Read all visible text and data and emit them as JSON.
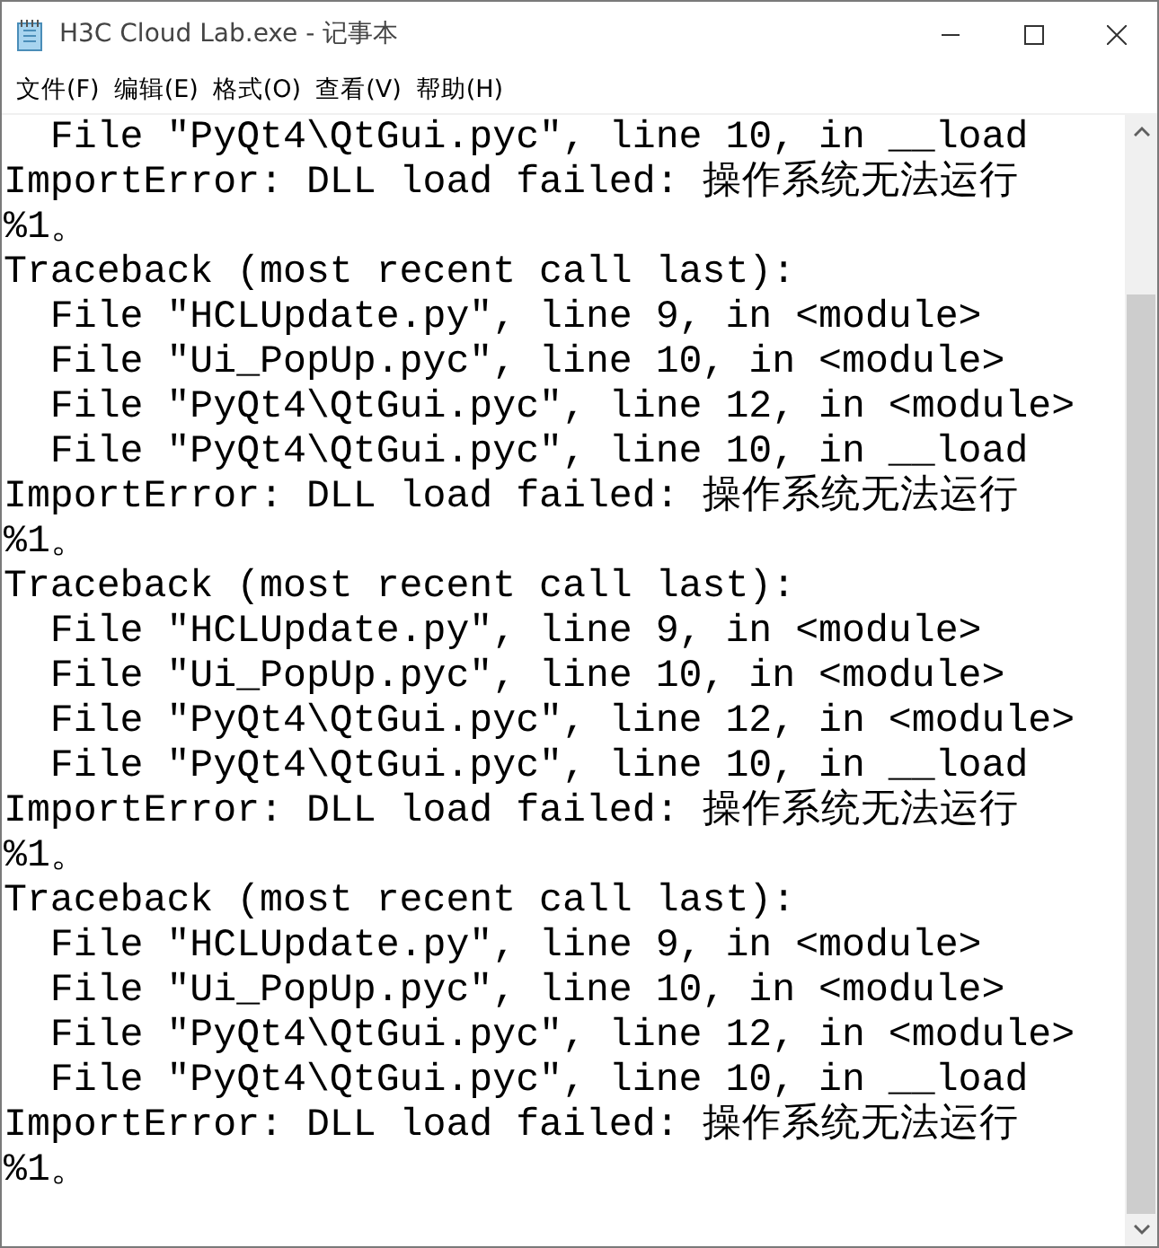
{
  "window": {
    "title": "H3C Cloud Lab.exe - 记事本"
  },
  "menu": [
    "文件(F)",
    "编辑(E)",
    "格式(O)",
    "查看(V)",
    "帮助(H)"
  ],
  "lines": [
    "  File \"PyQt4\\QtGui.pyc\", line 10, in __load",
    "ImportError: DLL load failed: 操作系统无法运行",
    "%1。",
    "Traceback (most recent call last):",
    "  File \"HCLUpdate.py\", line 9, in <module>",
    "  File \"Ui_PopUp.pyc\", line 10, in <module>",
    "  File \"PyQt4\\QtGui.pyc\", line 12, in <module>",
    "  File \"PyQt4\\QtGui.pyc\", line 10, in __load",
    "ImportError: DLL load failed: 操作系统无法运行",
    "%1。",
    "Traceback (most recent call last):",
    "  File \"HCLUpdate.py\", line 9, in <module>",
    "  File \"Ui_PopUp.pyc\", line 10, in <module>",
    "  File \"PyQt4\\QtGui.pyc\", line 12, in <module>",
    "  File \"PyQt4\\QtGui.pyc\", line 10, in __load",
    "ImportError: DLL load failed: 操作系统无法运行",
    "%1。",
    "Traceback (most recent call last):",
    "  File \"HCLUpdate.py\", line 9, in <module>",
    "  File \"Ui_PopUp.pyc\", line 10, in <module>",
    "  File \"PyQt4\\QtGui.pyc\", line 12, in <module>",
    "  File \"PyQt4\\QtGui.pyc\", line 10, in __load",
    "ImportError: DLL load failed: 操作系统无法运行",
    "%1。"
  ]
}
